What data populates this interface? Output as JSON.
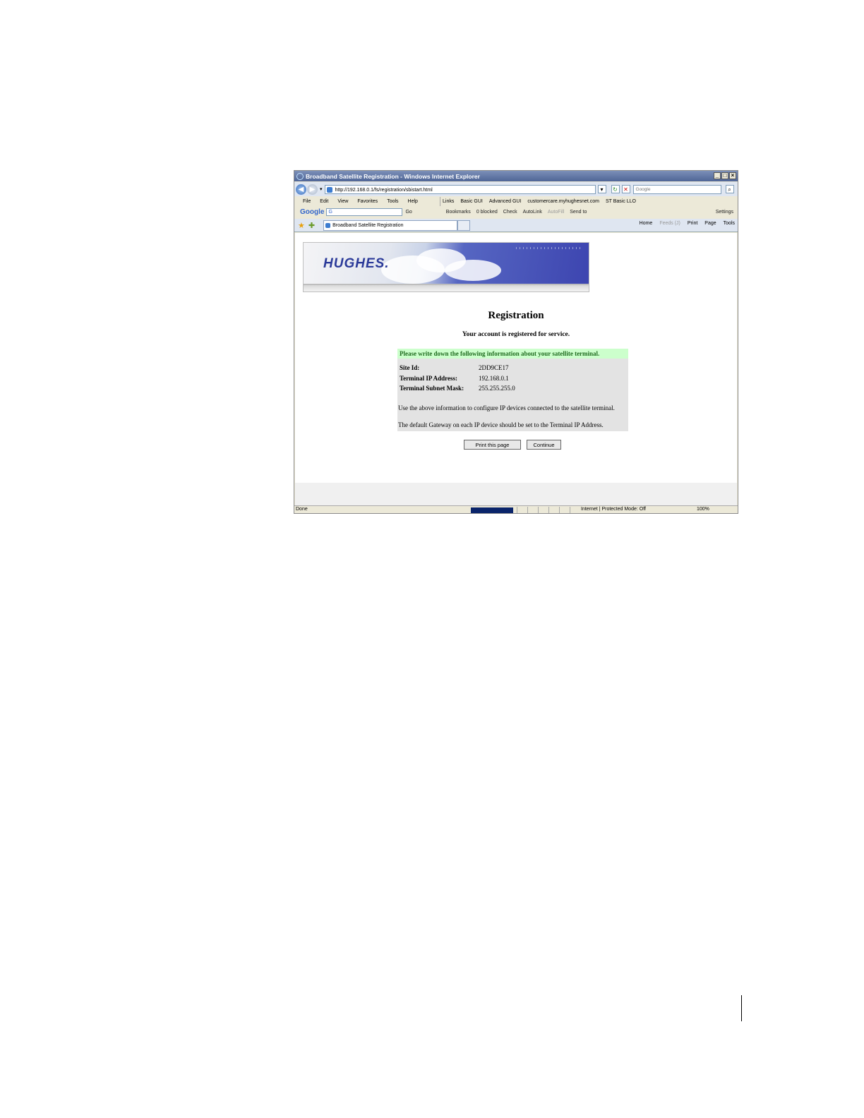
{
  "window": {
    "title": "Broadband Satellite Registration - Windows Internet Explorer",
    "controls": [
      "_",
      "□",
      "×"
    ]
  },
  "address_bar": {
    "url": "http://192.168.0.1/fs/registration/sbistart.html",
    "search_placeholder": "Google"
  },
  "menu": [
    "File",
    "Edit",
    "View",
    "Favorites",
    "Tools",
    "Help"
  ],
  "links_bar": [
    "Links",
    "Basic GUI",
    "Advanced GUI",
    "customercare.myhughesnet.com",
    "ST Basic LLO"
  ],
  "google_toolbar": {
    "logo": "Google",
    "input": "G",
    "items": [
      "Go",
      "Bookmarks",
      "0 blocked",
      "Check",
      "AutoLink",
      "AutoFill",
      "Send to",
      "Settings"
    ]
  },
  "tab": {
    "label": "Broadband Satellite Registration"
  },
  "command_bar": [
    "Home",
    "Feeds (J)",
    "Print",
    "Page",
    "Tools"
  ],
  "banner": {
    "logo": "HUGHES."
  },
  "page": {
    "title": "Registration",
    "subtitle": "Your account is registered for service.",
    "info_header": "Please write down the following information about your satellite terminal.",
    "rows": [
      {
        "label": "Site Id:",
        "value": "2DD9CE17"
      },
      {
        "label": "Terminal IP Address:",
        "value": "192.168.0.1"
      },
      {
        "label": "Terminal Subnet Mask:",
        "value": "255.255.255.0"
      }
    ],
    "note1": "Use the above information to configure IP devices connected to the satellite terminal.",
    "note2": "The default Gateway on each IP device should be set to the Terminal IP Address.",
    "print_button": "Print this page",
    "continue_button": "Continue"
  },
  "status_bar": {
    "status": "Done",
    "zone": "Internet | Protected Mode: Off",
    "zoom": "100%"
  }
}
